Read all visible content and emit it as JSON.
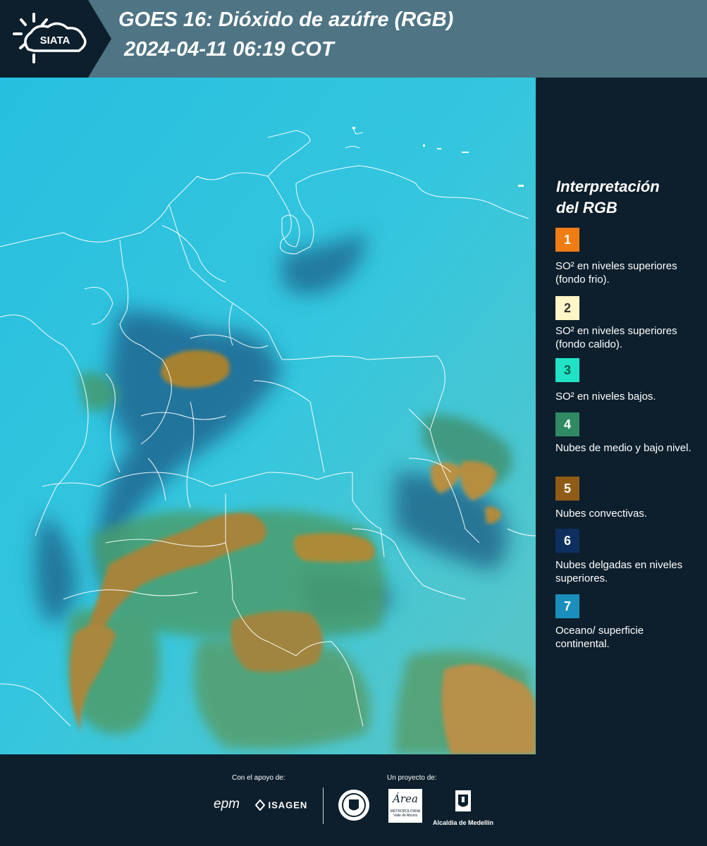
{
  "header": {
    "logo_text": "SIATA",
    "title_line1": "GOES 16: Dióxido de azúfre (RGB)",
    "title_line2": "2024-04-11 06:19 COT",
    "background_color": "#4f7585",
    "logo_block_color": "#0d1f2c"
  },
  "legend": {
    "title_line1": "Interpretación",
    "title_line2": "del RGB",
    "items": [
      {
        "number": "1",
        "color": "#f07d14",
        "label": "SO² en niveles superiores (fondo frio)."
      },
      {
        "number": "2",
        "color": "#fff6c8",
        "label": "SO² en niveles superiores (fondo calido)."
      },
      {
        "number": "3",
        "color": "#1fe3c4",
        "label": "SO² en niveles bajos."
      },
      {
        "number": "4",
        "color": "#2f8a64",
        "label": "Nubes de medio y bajo nivel."
      },
      {
        "number": "5",
        "color": "#8f5c16",
        "label": "Nubes convectivas."
      },
      {
        "number": "6",
        "color": "#0e2f60",
        "label": "Nubes delgadas en niveles superiores."
      },
      {
        "number": "7",
        "color": "#1b8fbc",
        "label": "Oceano/ superficie continental."
      }
    ]
  },
  "footer": {
    "support_label": "Con el apoyo de:",
    "project_label": "Un proyecto de:",
    "logo_epm": "epm",
    "logo_isagen": "ISAGEN",
    "logo_area_top": "Área",
    "logo_area_bottom1": "METROPOLITANA",
    "logo_area_bottom2": "Valle de Aburrá",
    "logo_alcaldia": "Alcaldía de Medellín"
  },
  "map_colors": {
    "surface": "#2fc3dd",
    "thin_cloud": "#1a4f7a",
    "convective": "#a8853a",
    "mid_low": "#3f9a7a",
    "border": "#ffffff"
  }
}
